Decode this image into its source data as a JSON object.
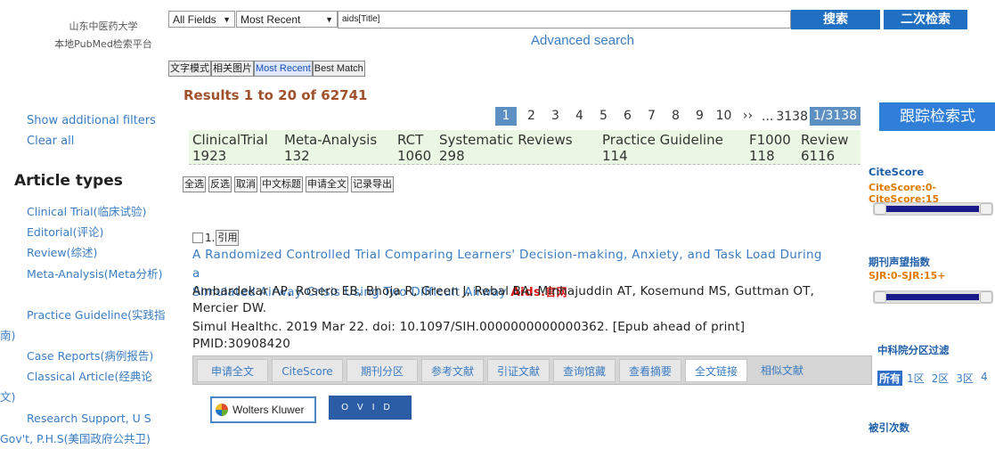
{
  "logo": {
    "line1": "山东中医药大学",
    "line2": "本地PubMed检索平台"
  },
  "search": {
    "field": "All Fields",
    "sort": "Most Recent",
    "query": "aids[Title]",
    "search_label": "搜索",
    "secondary_label": "二次检索",
    "advanced": "Advanced search"
  },
  "modes": [
    "文字模式",
    "相关图片",
    "Most Recent",
    "Best Match"
  ],
  "results_label": "Results 1 to 20 of 62741",
  "pager": {
    "pages": [
      "1",
      "2",
      "3",
      "4",
      "5",
      "6",
      "7",
      "8",
      "9",
      "10"
    ],
    "next": "››",
    "ellipsis": "...",
    "last": "3138",
    "current": "1/3138"
  },
  "track_button": "跟踪检索式",
  "sidebar": {
    "show_filters": "Show additional filters",
    "clear_all": "Clear all",
    "article_types_heading": "Article types",
    "items": [
      "Clinical Trial(临床试验)",
      "Editorial(评论)",
      "Review(综述)",
      "Meta-Analysis(Meta分析)",
      "Practice Guideline(实践指南)",
      "Case Reports(病例报告)",
      "Classical Article(经典论文)",
      "Research Support, U S Gov't, P.H.S(美国政府公共卫)"
    ]
  },
  "pubtypes": [
    {
      "name": "ClinicalTrial",
      "count": "1923"
    },
    {
      "name": "Meta-Analysis",
      "count": "132"
    },
    {
      "name": "RCT",
      "count": "1060"
    },
    {
      "name": "Systematic Reviews",
      "count": "298"
    },
    {
      "name": "Practice Guideline",
      "count": "114"
    },
    {
      "name": "F1000",
      "count": "118"
    },
    {
      "name": "Review",
      "count": "6116"
    }
  ],
  "actions": [
    "全选",
    "反选",
    "取消",
    "中文标题",
    "申请全文",
    "记录导出"
  ],
  "result": {
    "index": "1.",
    "cite": "引用",
    "title_line1": "A Randomized Controlled Trial Comparing Learners' Decision-making, Anxiety, and Task Load During a",
    "title_line2": "Simulated Airway Crisis Using Two Difficult Airway",
    "title_highlight": "Aids",
    "title_tag": ".官网",
    "authors_line1": "Ambardekar AP, Rosero EB, Bhoja R, Green J, Rebal BA, Minhajuddin AT, Kosemund MS, Guttman OT,",
    "authors_line2": "Mercier DW.",
    "journal": "Simul Healthc. 2019 Mar 22. doi: 10.1097/SIH.0000000000000362. [Epub ahead of print]",
    "pmid": "PMID:30908420",
    "tabs": [
      "申请全文",
      "CiteScore",
      "期刊分区",
      "参考文献",
      "引证文献",
      "查询馆藏",
      "查看摘要",
      "全文链接",
      "相似文献"
    ],
    "selected_tab": "全文链接",
    "providers": {
      "wk": "Wolters Kluwer",
      "ovid": "OVID"
    }
  },
  "right": {
    "citescore_title": "CiteScore",
    "citescore_range": "CiteScore:0-CiteScore:15",
    "sjr_title": "期刊声望指数",
    "sjr_range": "SJR:0-SJR:15+",
    "zone_title": "中科院分区过滤",
    "zones": [
      "所有",
      "1区",
      "2区",
      "3区",
      "4"
    ],
    "cited_title": "被引次数"
  },
  "colors": {
    "accent": "#1f6fc3",
    "link": "#3a7cc2",
    "results": "#a0522d",
    "highlight": "#d9120f"
  }
}
